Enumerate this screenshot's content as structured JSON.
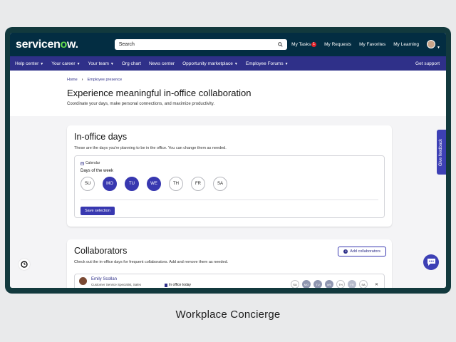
{
  "brand": {
    "logo_prefix": "servicen",
    "logo_o": "o",
    "logo_suffix": "w.",
    "accent": "#62d84e"
  },
  "search": {
    "placeholder": "Search"
  },
  "toplinks": {
    "tasks": "My Tasks",
    "tasks_badge": "1",
    "requests": "My Requests",
    "favorites": "My Favorites",
    "learning": "My Learning"
  },
  "nav": {
    "items": [
      "Help center",
      "Your career",
      "Your team",
      "Org chart",
      "News center",
      "Opportunity marketplace",
      "Employee Forums"
    ],
    "dropdowns": [
      true,
      true,
      true,
      false,
      false,
      true,
      true
    ],
    "support": "Get support"
  },
  "breadcrumb": {
    "home": "Home",
    "current": "Employee presence"
  },
  "hero": {
    "title": "Experience meaningful in-office collaboration",
    "subtitle": "Coordinate your days, make personal connections, and maximize productivity."
  },
  "inoffice": {
    "title": "In-office days",
    "description": "These are the days you're planning to be in the office. You can change them as needed.",
    "calendar_label": "Calendar",
    "days_title": "Days of the week",
    "days": [
      {
        "label": "SU",
        "selected": false
      },
      {
        "label": "MO",
        "selected": true
      },
      {
        "label": "TU",
        "selected": true
      },
      {
        "label": "WE",
        "selected": true
      },
      {
        "label": "TH",
        "selected": false
      },
      {
        "label": "FR",
        "selected": false
      },
      {
        "label": "SA",
        "selected": false
      }
    ],
    "save_label": "Save selection"
  },
  "collaborators": {
    "title": "Collaborators",
    "description": "Check out the in-office days for frequent collaborators. Add and remove them as needed.",
    "add_label": "Add collaborators",
    "list": [
      {
        "name": "Emily Scollan",
        "role": "Customer Service Specialist, Sales",
        "status": "In office today",
        "days": [
          {
            "label": "SU",
            "state": "none"
          },
          {
            "label": "MO",
            "state": "selected"
          },
          {
            "label": "TU",
            "state": "selected"
          },
          {
            "label": "WE",
            "state": "selected"
          },
          {
            "label": "TH",
            "state": "none"
          },
          {
            "label": "FR",
            "state": "light"
          },
          {
            "label": "SA",
            "state": "none"
          }
        ]
      }
    ]
  },
  "feedback": {
    "label": "Give feedback"
  },
  "caption": "Workplace Concierge",
  "colors": {
    "nav": "#2f3089",
    "topbar": "#032d42",
    "primary": "#3838b0",
    "frame": "#12393d"
  }
}
